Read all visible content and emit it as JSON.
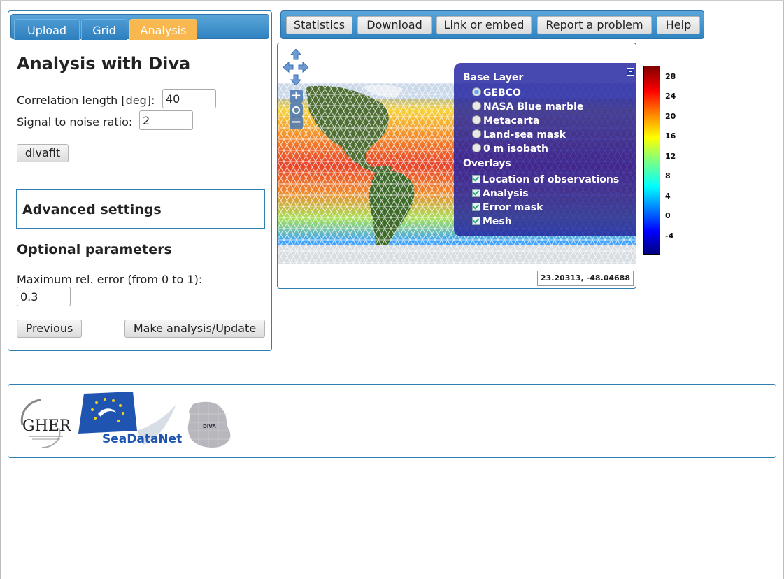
{
  "tabs": [
    {
      "label": "Upload",
      "active": false
    },
    {
      "label": "Grid",
      "active": false
    },
    {
      "label": "Analysis",
      "active": true
    }
  ],
  "panel": {
    "title": "Analysis with Diva",
    "correlation_label": "Correlation length [deg]:",
    "correlation_value": "40",
    "snr_label": "Signal to noise ratio:",
    "snr_value": "2",
    "divafit_label": "divafit",
    "advanced_label": "Advanced settings",
    "optional_label": "Optional parameters",
    "max_error_label": "Maximum rel. error (from 0 to 1):",
    "max_error_value": "0.3",
    "previous_label": "Previous",
    "make_analysis_label": "Make analysis/Update"
  },
  "toolbar": {
    "buttons": [
      "Statistics",
      "Download",
      "Link or embed",
      "Report a problem",
      "Help"
    ]
  },
  "map": {
    "layer_switcher": {
      "base_heading": "Base Layer",
      "base_layers": [
        {
          "label": "GEBCO",
          "selected": true
        },
        {
          "label": "NASA Blue marble",
          "selected": false
        },
        {
          "label": "Metacarta",
          "selected": false
        },
        {
          "label": "Land-sea mask",
          "selected": false
        },
        {
          "label": "0 m isobath",
          "selected": false
        }
      ],
      "overlay_heading": "Overlays",
      "overlays": [
        {
          "label": "Location of observations",
          "checked": true
        },
        {
          "label": "Analysis",
          "checked": true
        },
        {
          "label": "Error mask",
          "checked": true
        },
        {
          "label": "Mesh",
          "checked": true
        }
      ]
    },
    "zoom_in": "+",
    "zoom_out": "−",
    "coordinates": "23.20313, -48.04688"
  },
  "colorbar": {
    "labels": [
      "28",
      "24",
      "20",
      "16",
      "12",
      "8",
      "4",
      "0",
      "-4"
    ]
  },
  "footer": {
    "logos": [
      "GHER",
      "SeaDataNet",
      "DIVA"
    ]
  },
  "colors": {
    "tab_active": "#f9b74f",
    "panel_border": "#2f7fb3",
    "toolbar_bg": "#2f84c2"
  }
}
